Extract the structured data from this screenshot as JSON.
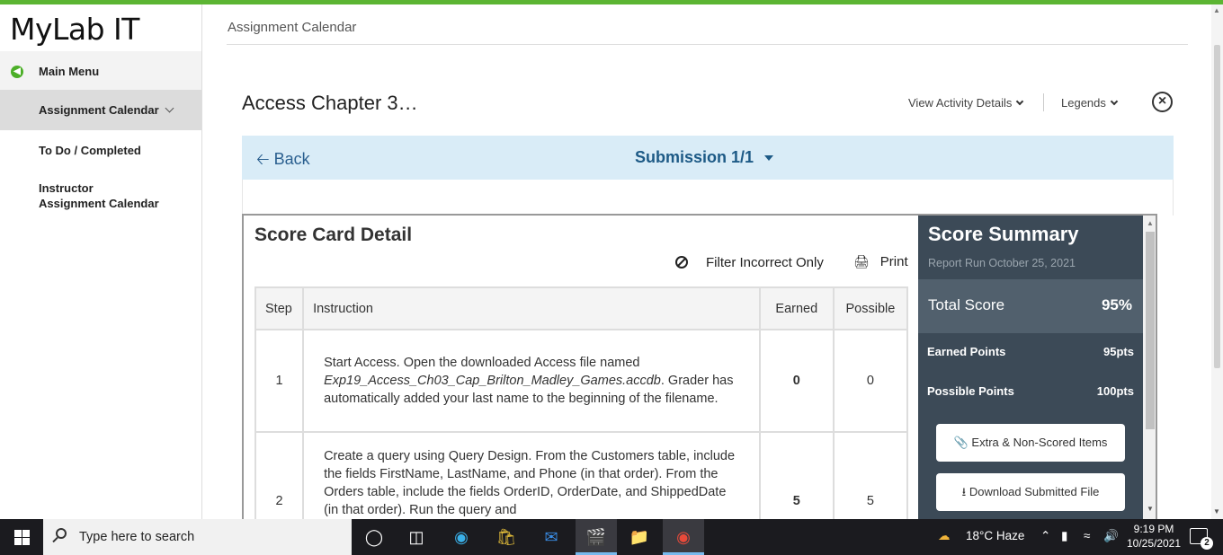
{
  "app": {
    "logo": "MyLab IT"
  },
  "sidebar": {
    "items": [
      {
        "label": "Main Menu"
      },
      {
        "label": "Assignment Calendar"
      },
      {
        "label": "To Do / Completed"
      },
      {
        "label_line1": "Instructor",
        "label_line2": "Assignment Calendar"
      }
    ]
  },
  "breadcrumb": "Assignment Calendar",
  "activity": {
    "title": "Access Chapter 3…",
    "view_details_label": "View Activity Details",
    "legends_label": "Legends"
  },
  "subbar": {
    "back_label": "Back",
    "submission_label": "Submission 1/1"
  },
  "scorecard": {
    "title": "Score Card Detail",
    "filter_label": "Filter Incorrect Only",
    "print_label": "Print",
    "columns": {
      "step": "Step",
      "instruction": "Instruction",
      "earned": "Earned",
      "possible": "Possible"
    },
    "rows": [
      {
        "step": "1",
        "instruction_a": "Start Access. Open the downloaded Access file named",
        "instruction_file": "Exp19_Access_Ch03_Cap_Brilton_Madley_Games.accdb",
        "instruction_b": ". Grader has automatically added your last name to the beginning of the filename.",
        "earned": "0",
        "possible": "0"
      },
      {
        "step": "2",
        "instruction": "Create a query using Query Design. From the Customers table, include the fields FirstName, LastName, and Phone (in that order). From the Orders table, include the fields OrderID, OrderDate, and ShippedDate (in that order). Run the query and",
        "earned": "5",
        "possible": "5"
      }
    ]
  },
  "summary": {
    "title": "Score Summary",
    "report_run": "Report Run October 25, 2021",
    "total_label": "Total Score",
    "total_value": "95%",
    "earned_label": "Earned Points",
    "earned_value": "95pts",
    "possible_label": "Possible Points",
    "possible_value": "100pts",
    "extra_button": "Extra & Non-Scored Items",
    "download_button": "Download Submitted File"
  },
  "taskbar": {
    "search_placeholder": "Type here to search",
    "weather": "18°C  Haze",
    "time": "9:19 PM",
    "date": "10/25/2021",
    "notification_count": "2"
  },
  "colors": {
    "accent_green": "#5cb533",
    "subbar_bg": "#d9ecf7",
    "link_blue": "#1d5a86",
    "summary_bg": "#3c4a57"
  }
}
